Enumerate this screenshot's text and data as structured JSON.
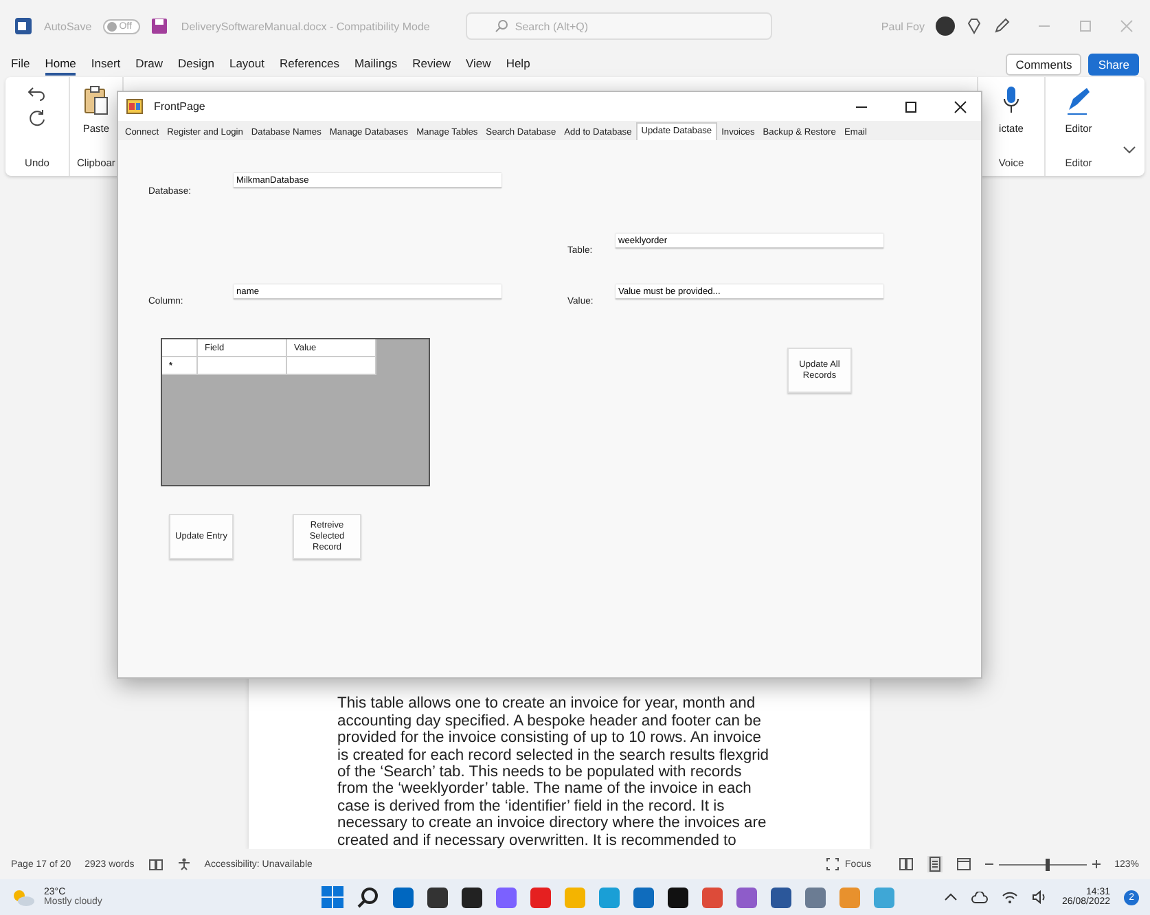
{
  "word_title_bar": {
    "autosave_label": "AutoSave",
    "autosave_toggle": {
      "label": "Off",
      "on": false
    },
    "document_title": "DeliverySoftwareManual.docx  -  Compatibility Mode",
    "search": {
      "placeholder": "Search (Alt+Q)"
    },
    "user_name": "Paul Foy"
  },
  "menu_tabs": [
    {
      "label": "File",
      "selected": false
    },
    {
      "label": "Home",
      "selected": true
    },
    {
      "label": "Insert",
      "selected": false
    },
    {
      "label": "Draw",
      "selected": false
    },
    {
      "label": "Design",
      "selected": false
    },
    {
      "label": "Layout",
      "selected": false
    },
    {
      "label": "References",
      "selected": false
    },
    {
      "label": "Mailings",
      "selected": false
    },
    {
      "label": "Review",
      "selected": false
    },
    {
      "label": "View",
      "selected": false
    },
    {
      "label": "Help",
      "selected": false
    }
  ],
  "menu_buttons": {
    "comments": "Comments",
    "share": "Share"
  },
  "ribbon": {
    "paste_label": "Paste",
    "undo_group": "Undo",
    "clipboard_group": "Clipboar",
    "dictate_label": "ictate",
    "voice_group": "Voice",
    "editor_label": "Editor",
    "editor_group": "Editor"
  },
  "app_window": {
    "title": "FrontPage",
    "tabs": [
      {
        "label": "Connect",
        "selected": false
      },
      {
        "label": "Register and Login",
        "selected": false
      },
      {
        "label": "Database Names",
        "selected": false
      },
      {
        "label": "Manage Databases",
        "selected": false
      },
      {
        "label": "Manage Tables",
        "selected": false
      },
      {
        "label": "Search Database",
        "selected": false
      },
      {
        "label": "Add to Database",
        "selected": false
      },
      {
        "label": "Update Database",
        "selected": true
      },
      {
        "label": "Invoices",
        "selected": false
      },
      {
        "label": "Backup & Restore",
        "selected": false
      },
      {
        "label": "Email",
        "selected": false
      }
    ],
    "database": {
      "label": "Database:",
      "value": "MilkmanDatabase"
    },
    "table": {
      "label": "Table:",
      "value": "weeklyorder"
    },
    "column": {
      "label": "Column:",
      "value": "name"
    },
    "value": {
      "label": "Value:",
      "value": "Value must be provided..."
    },
    "grid": {
      "columns": [
        "Field",
        "Value"
      ],
      "new_row_marker": "*"
    },
    "buttons": {
      "update_all": "Update All Records",
      "update_entry": "Update Entry",
      "retrieve": "Retreive Selected Record"
    }
  },
  "document": {
    "lines": [
      "This table allows one to create an invoice for year, month and",
      "accounting day specified. A bespoke header and footer can be",
      "provided for the invoice consisting of up to 10 rows. An invoice",
      "is created for each record selected in the search results flexgrid",
      "of the ‘Search’ tab. This needs to be populated with records",
      "from the ‘weeklyorder’ table. The name of the invoice in each",
      "case is derived from the ‘identifier’ field in the record. It is",
      "necessary to create an invoice directory where the invoices are",
      "created and if necessary overwritten. It is recommended to"
    ]
  },
  "status_bar": {
    "page": "Page 17 of 20",
    "words": "2923 words",
    "accessibility": "Accessibility: Unavailable",
    "focus": "Focus",
    "zoom": {
      "level": 0.55
    },
    "zoom_percent": "123%"
  },
  "taskbar": {
    "temperature": "23°C",
    "weather": "Mostly cloudy",
    "time": "14:31",
    "date": "26/08/2022",
    "notification_count": "2"
  }
}
